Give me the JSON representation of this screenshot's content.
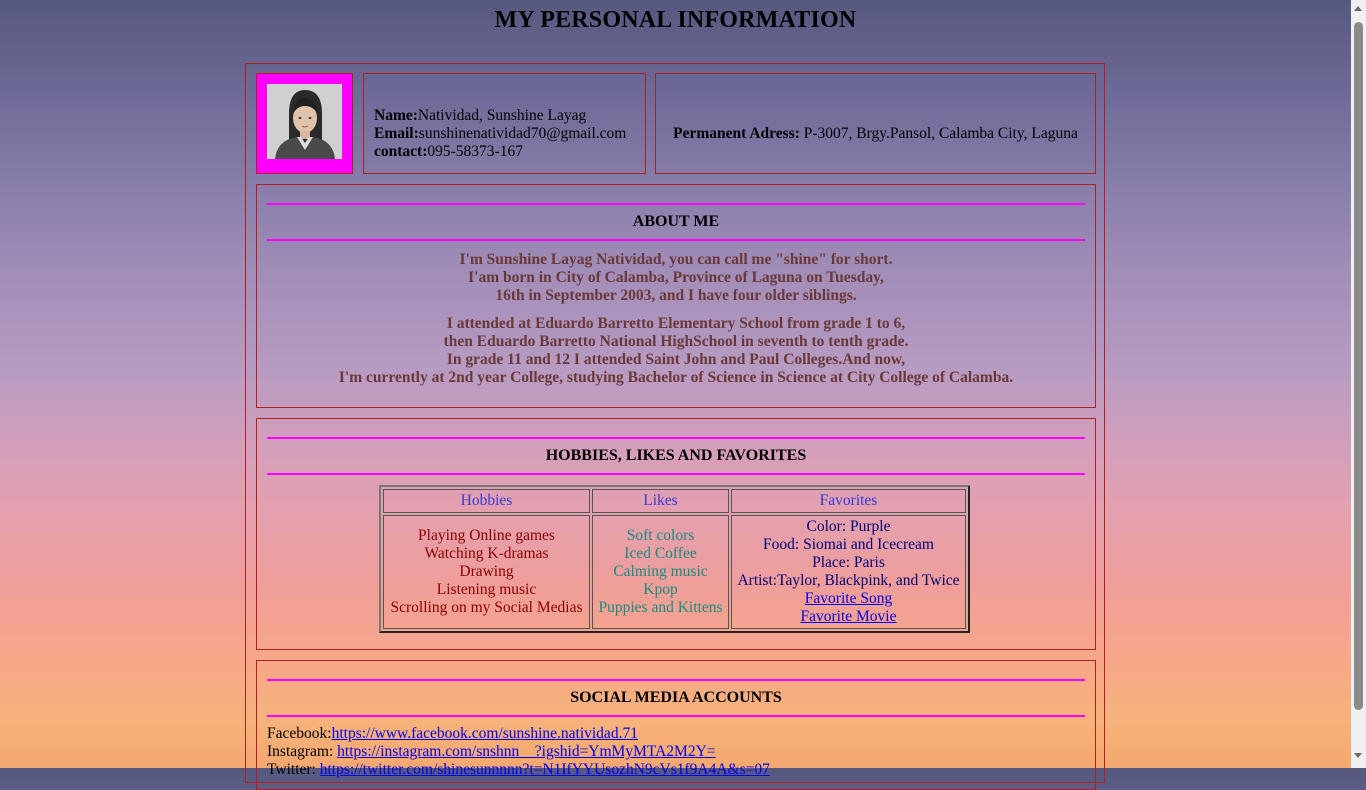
{
  "page_title": "MY PERSONAL INFORMATION",
  "contact": {
    "name_label": "Name:",
    "name_value": "Natividad, Sunshine Layag",
    "email_label": "Email:",
    "email_value": "sunshinenatividad70@gmail.com",
    "contact_label": "contact:",
    "contact_value": "095-58373-167"
  },
  "address": {
    "label": "Permanent Adress:",
    "value": " P-3007, Brgy.Pansol, Calamba City, Laguna"
  },
  "about": {
    "title": "ABOUT ME",
    "para1": [
      "I'm Sunshine Layag Natividad, you can call me \"shine\" for short.",
      "I'am born in City of Calamba, Province of Laguna on Tuesday,",
      "16th in September 2003, and I have four older siblings."
    ],
    "para2": [
      "I attended at Eduardo Barretto Elementary School from grade 1 to 6,",
      "then Eduardo Barretto National HighSchool in seventh to tenth grade.",
      "In grade 11 and 12 I attended Saint John and Paul Colleges.And now,",
      "I'm currently at 2nd year College, studying Bachelor of Science in Science at City College of Calamba."
    ]
  },
  "hobbies_section": {
    "title": "HOBBIES, LIKES AND FAVORITES",
    "headers": [
      "Hobbies",
      "Likes",
      "Favorites"
    ],
    "hobbies": [
      "Playing Online games",
      "Watching K-dramas",
      "Drawing",
      "Listening music",
      "Scrolling on my Social Medias"
    ],
    "likes": [
      "Soft colors",
      "Iced Coffee",
      "Calming music",
      "Kpop",
      "Puppies and Kittens"
    ],
    "favorites": [
      "Color: Purple",
      "Food: Siomai and Icecream",
      "Place: Paris",
      "Artist:Taylor, Blackpink, and Twice"
    ],
    "favorite_links": [
      "Favorite Song",
      "Favorite Movie"
    ]
  },
  "social": {
    "title": "SOCIAL MEDIA ACCOUNTS",
    "facebook_label": "Facebook:",
    "facebook_url": "https://www.facebook.com/sunshine.natividad.71",
    "instagram_label": "Instagram: ",
    "instagram_url": "https://instagram.com/snshnn__?igshid=YmMyMTA2M2Y=",
    "twitter_label": "Twitter: ",
    "twitter_url": "https://twitter.com/shinesunnnnn?t=N1IfYYUsozhN9cVs1f9A4A&s=07"
  },
  "colors": {
    "border": "#b02020",
    "accent_magenta": "#ff00ff",
    "link": "#0000ee"
  }
}
